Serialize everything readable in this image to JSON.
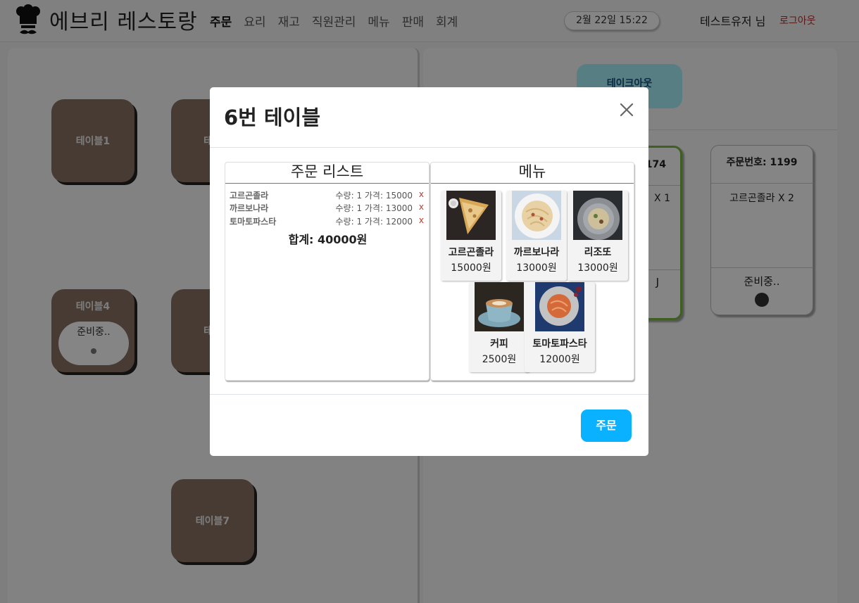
{
  "header": {
    "brand": "에브리 레스토랑",
    "nav": [
      "주문",
      "요리",
      "재고",
      "직원관리",
      "메뉴",
      "판매",
      "회계"
    ],
    "datetime": "2월 22일 15:22",
    "user": "테스트유저 님",
    "logout": "로그아웃"
  },
  "tables": [
    {
      "label": "테이블1"
    },
    {
      "label": "테이"
    },
    {
      "label": "테이블4",
      "status": "준비중.."
    },
    {
      "label": "테이"
    },
    {
      "label": "테이블7"
    }
  ],
  "right": {
    "takeout": "테이크아웃",
    "cards": [
      {
        "number": "174",
        "item": "X 1",
        "status": "J"
      },
      {
        "number": "주문번호: 1199",
        "item": "고르곤졸라 X 2",
        "status": "준비중.."
      }
    ]
  },
  "modal": {
    "title": "6번 테이블",
    "order_panel_title": "주문 리스트",
    "menu_panel_title": "메뉴",
    "orders": [
      {
        "name": "고르곤졸라",
        "detail": "수량: 1 가격: 15000",
        "remove": "x"
      },
      {
        "name": "까르보나라",
        "detail": "수량: 1 가격: 13000",
        "remove": "x"
      },
      {
        "name": "토마토파스타",
        "detail": "수량: 1 가격: 12000",
        "remove": "x"
      }
    ],
    "total": "합계: 40000원",
    "menu": [
      {
        "name": "고르곤졸라",
        "price": "15000원",
        "icon": "pizza-photo"
      },
      {
        "name": "까르보나라",
        "price": "13000원",
        "icon": "carbonara-photo"
      },
      {
        "name": "리조또",
        "price": "13000원",
        "icon": "risotto-photo"
      },
      {
        "name": "커피",
        "price": "2500원",
        "icon": "coffee-photo"
      },
      {
        "name": "토마토파스타",
        "price": "12000원",
        "icon": "tomato-pasta-photo"
      }
    ],
    "submit": "주문"
  },
  "colors": {
    "table_tile": "#8a7262",
    "submit_button": "#0ab1ff",
    "takeout_button": "#a8f4fb",
    "logout": "#b03030"
  }
}
